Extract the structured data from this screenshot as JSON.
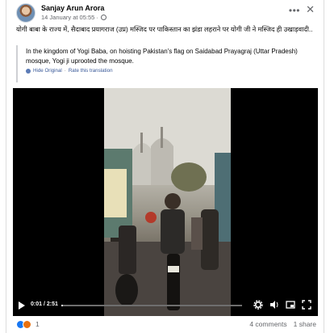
{
  "post": {
    "author": "Sanjay Arun Arora",
    "date": "14 January at 05:55",
    "original_text": "योगी बाबा के राज्य में, सैदाबाद प्रयागराज (उप्र) मस्जिद पर पाकिस्तान का झंडा लहराने पर योगी जी ने मस्जिद ही उखाड़वादी..",
    "translation_text": "In the kingdom of Yogi Baba, on hoisting Pakistan's flag on Saidabad Prayagraj (Uttar Pradesh) mosque, Yogi ji uprooted the mosque.",
    "hide_original": "Hide Original",
    "separator": "·",
    "rate_translation": "Rate this translation"
  },
  "video": {
    "time": "0:01 / 2:51",
    "progress_fraction": 0.006
  },
  "footer": {
    "reactions_count": "1",
    "comments": "4 comments",
    "shares": "1 share"
  },
  "colors": {
    "link": "#385898",
    "muted": "#65676b",
    "like_blue": "#1877f2"
  }
}
